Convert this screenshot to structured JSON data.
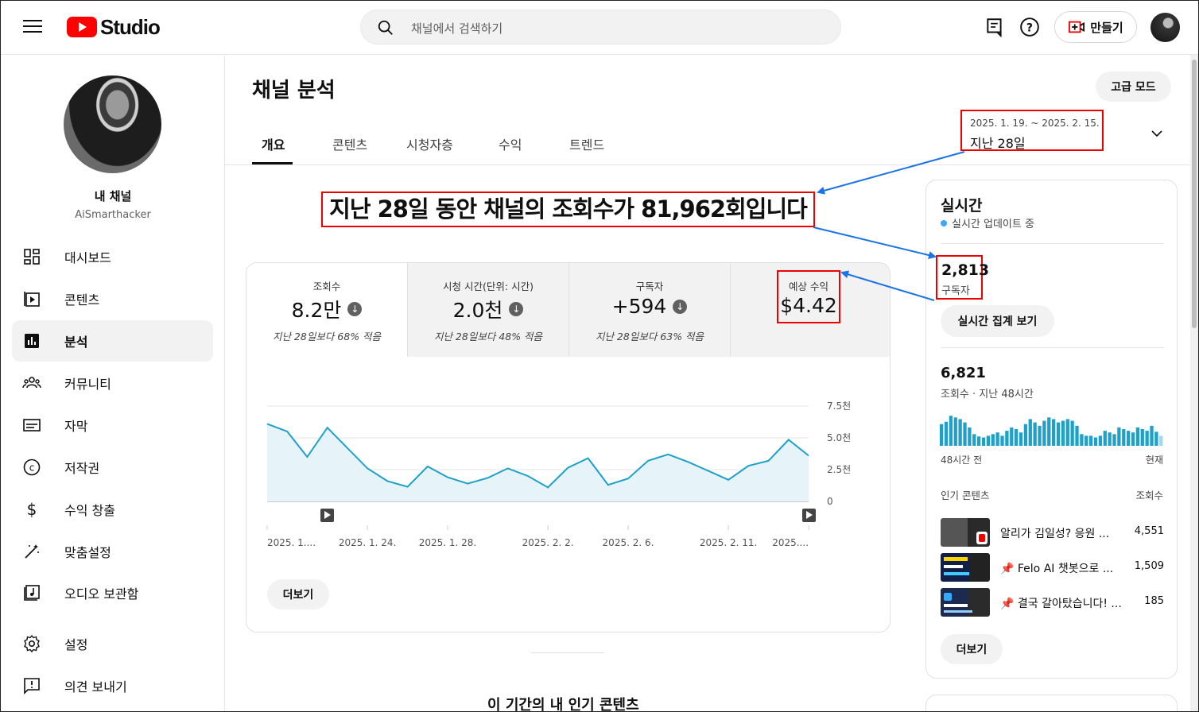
{
  "header": {
    "logo_text": "Studio",
    "search_placeholder": "채널에서 검색하기",
    "create_label": "만들기"
  },
  "sidebar": {
    "channel_label": "내 채널",
    "channel_handle": "AiSmarthacker",
    "items": [
      {
        "label": "대시보드",
        "icon": "dashboard-icon"
      },
      {
        "label": "콘텐츠",
        "icon": "content-icon"
      },
      {
        "label": "분석",
        "icon": "analytics-icon",
        "active": true
      },
      {
        "label": "커뮤니티",
        "icon": "community-icon"
      },
      {
        "label": "자막",
        "icon": "subtitles-icon"
      },
      {
        "label": "저작권",
        "icon": "copyright-icon"
      },
      {
        "label": "수익 창출",
        "icon": "dollar-icon"
      },
      {
        "label": "맞춤설정",
        "icon": "magic-wand-icon"
      },
      {
        "label": "오디오 보관함",
        "icon": "audio-library-icon"
      },
      {
        "label": "설정",
        "icon": "gear-icon"
      },
      {
        "label": "의견 보내기",
        "icon": "feedback-icon"
      }
    ]
  },
  "main": {
    "title": "채널 분석",
    "advanced_label": "고급 모드",
    "tabs": [
      "개요",
      "콘텐츠",
      "시청자층",
      "수익",
      "트렌드"
    ],
    "date_range": "2025. 1. 19. ~ 2025. 2. 15.",
    "date_label": "지난 28일",
    "headline": "지난 28일 동안 채널의 조회수가 81,962회입니다",
    "metrics": [
      {
        "title": "조회수",
        "value": "8.2만",
        "compare": "지난 28일보다 68% 적음",
        "trend": "down"
      },
      {
        "title": "시청 시간(단위: 시간)",
        "value": "2.0천",
        "compare": "지난 28일보다 48% 적음",
        "trend": "down"
      },
      {
        "title": "구독자",
        "value": "+594",
        "compare": "지난 28일보다 63% 적음",
        "trend": "down"
      },
      {
        "title": "예상 수익",
        "value": "$4.42"
      }
    ],
    "more_label": "더보기",
    "popular_title": "이 기간의 내 인기 콘텐츠"
  },
  "chart_data": {
    "type": "area",
    "x": [
      "2025. 1. 19.",
      "2025. 1. 20.",
      "2025. 1. 21.",
      "2025. 1. 22.",
      "2025. 1. 23.",
      "2025. 1. 24.",
      "2025. 1. 25.",
      "2025. 1. 26.",
      "2025. 1. 27.",
      "2025. 1. 28.",
      "2025. 1. 29.",
      "2025. 1. 30.",
      "2025. 1. 31.",
      "2025. 2. 1.",
      "2025. 2. 2.",
      "2025. 2. 3.",
      "2025. 2. 4.",
      "2025. 2. 5.",
      "2025. 2. 6.",
      "2025. 2. 7.",
      "2025. 2. 8.",
      "2025. 2. 9.",
      "2025. 2. 10.",
      "2025. 2. 11.",
      "2025. 2. 12.",
      "2025. 2. 13.",
      "2025. 2. 14.",
      "2025. 2. 15."
    ],
    "values": [
      6100,
      5500,
      3500,
      5800,
      4200,
      2600,
      1600,
      1150,
      2750,
      1900,
      1400,
      1850,
      2600,
      2000,
      1100,
      2650,
      3400,
      1300,
      1800,
      3200,
      3700,
      3100,
      2400,
      1700,
      2800,
      3200,
      4850,
      3600
    ],
    "x_tick_labels": [
      "2025. 1....",
      "2025. 1. 24.",
      "2025. 1. 28.",
      "2025. 2. 2.",
      "2025. 2. 6.",
      "2025. 2. 11.",
      "2025...."
    ],
    "y_tick_labels": [
      "0",
      "2.5천",
      "5.0천",
      "7.5천"
    ],
    "ylim": [
      0,
      7500
    ],
    "grid": true,
    "color": "#1da1c9"
  },
  "realtime": {
    "title": "실시간",
    "live_label": "실시간 업데이트 중",
    "subscribers": "2,813",
    "subscribers_label": "구독자",
    "realtime_button": "실시간 집계 보기",
    "views": "6,821",
    "views_label": "조회수 · 지난 48시간",
    "hourly_bars": [
      0.65,
      0.72,
      0.9,
      0.85,
      0.8,
      0.7,
      0.55,
      0.35,
      0.28,
      0.25,
      0.3,
      0.35,
      0.4,
      0.3,
      0.45,
      0.55,
      0.5,
      0.4,
      0.65,
      0.8,
      0.7,
      0.6,
      0.75,
      0.85,
      0.8,
      0.7,
      0.75,
      0.8,
      0.75,
      0.6,
      0.35,
      0.3,
      0.3,
      0.25,
      0.3,
      0.45,
      0.4,
      0.35,
      0.55,
      0.5,
      0.45,
      0.4,
      0.55,
      0.5,
      0.45,
      0.6,
      0.42,
      0.3
    ],
    "start_label": "48시간 전",
    "end_label": "현재",
    "popular_header": "인기 콘텐츠",
    "popular_views_header": "조회수",
    "popular": [
      {
        "title": "알리가 김일성? 응원 ...",
        "views": "4,551"
      },
      {
        "title": "📌 Felo AI 챗봇으로 ...",
        "views": "1,509"
      },
      {
        "title": "📌 결국 갈아탔습니다! ...",
        "views": "185"
      }
    ],
    "more_label": "더보기"
  },
  "colors": {
    "accent": "#1da1c9",
    "highlight": "#e00000",
    "arrow": "#1a73e8"
  }
}
